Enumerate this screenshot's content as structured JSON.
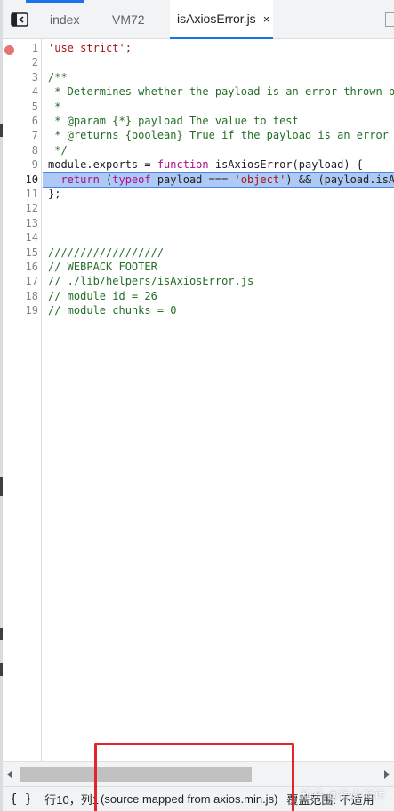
{
  "tabs": [
    {
      "label": "index"
    },
    {
      "label": "VM72"
    },
    {
      "label": "isAxiosError.js",
      "close": "×"
    }
  ],
  "editor": {
    "current_line": 10,
    "breakpoint_line": 1,
    "lines": [
      {
        "n": "1",
        "text": "'use strict';",
        "kind": "string"
      },
      {
        "n": "2",
        "text": "",
        "kind": "plain"
      },
      {
        "n": "3",
        "text": "/**",
        "kind": "comment"
      },
      {
        "n": "4",
        "text": " * Determines whether the payload is an error thrown by Axios",
        "kind": "comment"
      },
      {
        "n": "5",
        "text": " *",
        "kind": "comment"
      },
      {
        "n": "6",
        "text": " * @param {*} payload The value to test",
        "kind": "comment"
      },
      {
        "n": "7",
        "text": " * @returns {boolean} True if the payload is an error thrown by Axios, otherwise false",
        "kind": "comment"
      },
      {
        "n": "8",
        "text": " */",
        "kind": "comment"
      },
      {
        "n": "9",
        "kind": "mixed",
        "parts": [
          {
            "t": "module.exports = ",
            "c": "plain"
          },
          {
            "t": "function",
            "c": "kw"
          },
          {
            "t": " isAxiosError(payload) {",
            "c": "plain"
          }
        ]
      },
      {
        "n": "10",
        "kind": "mixed",
        "parts": [
          {
            "t": "  return",
            "c": "kw"
          },
          {
            "t": " (",
            "c": "plain"
          },
          {
            "t": "typeof",
            "c": "kw"
          },
          {
            "t": " payload === ",
            "c": "plain"
          },
          {
            "t": "'object'",
            "c": "str"
          },
          {
            "t": ") && (payload.isAxiosError === true);",
            "c": "plain"
          }
        ]
      },
      {
        "n": "11",
        "text": "};",
        "kind": "plain"
      },
      {
        "n": "12",
        "text": "",
        "kind": "plain"
      },
      {
        "n": "13",
        "text": "",
        "kind": "plain"
      },
      {
        "n": "14",
        "text": "",
        "kind": "plain"
      },
      {
        "n": "15",
        "text": "//////////////////",
        "kind": "comment"
      },
      {
        "n": "16",
        "text": "// WEBPACK FOOTER",
        "kind": "comment"
      },
      {
        "n": "17",
        "text": "// ./lib/helpers/isAxiosError.js",
        "kind": "comment"
      },
      {
        "n": "18",
        "text": "// module id = 26",
        "kind": "comment"
      },
      {
        "n": "19",
        "text": "// module chunks = 0",
        "kind": "comment"
      }
    ]
  },
  "status": {
    "format_icon": "{ }",
    "position": "行10，列1",
    "source_map": "(source mapped from axios.min.js)",
    "coverage": "覆盖范围: 不适用"
  },
  "watermark": "知乎 @指尖流转",
  "colors": {
    "highlight": "#aec9f4",
    "accent": "#1a73e8",
    "breakpoint": "#e57373",
    "annotation": "#e3242b"
  }
}
